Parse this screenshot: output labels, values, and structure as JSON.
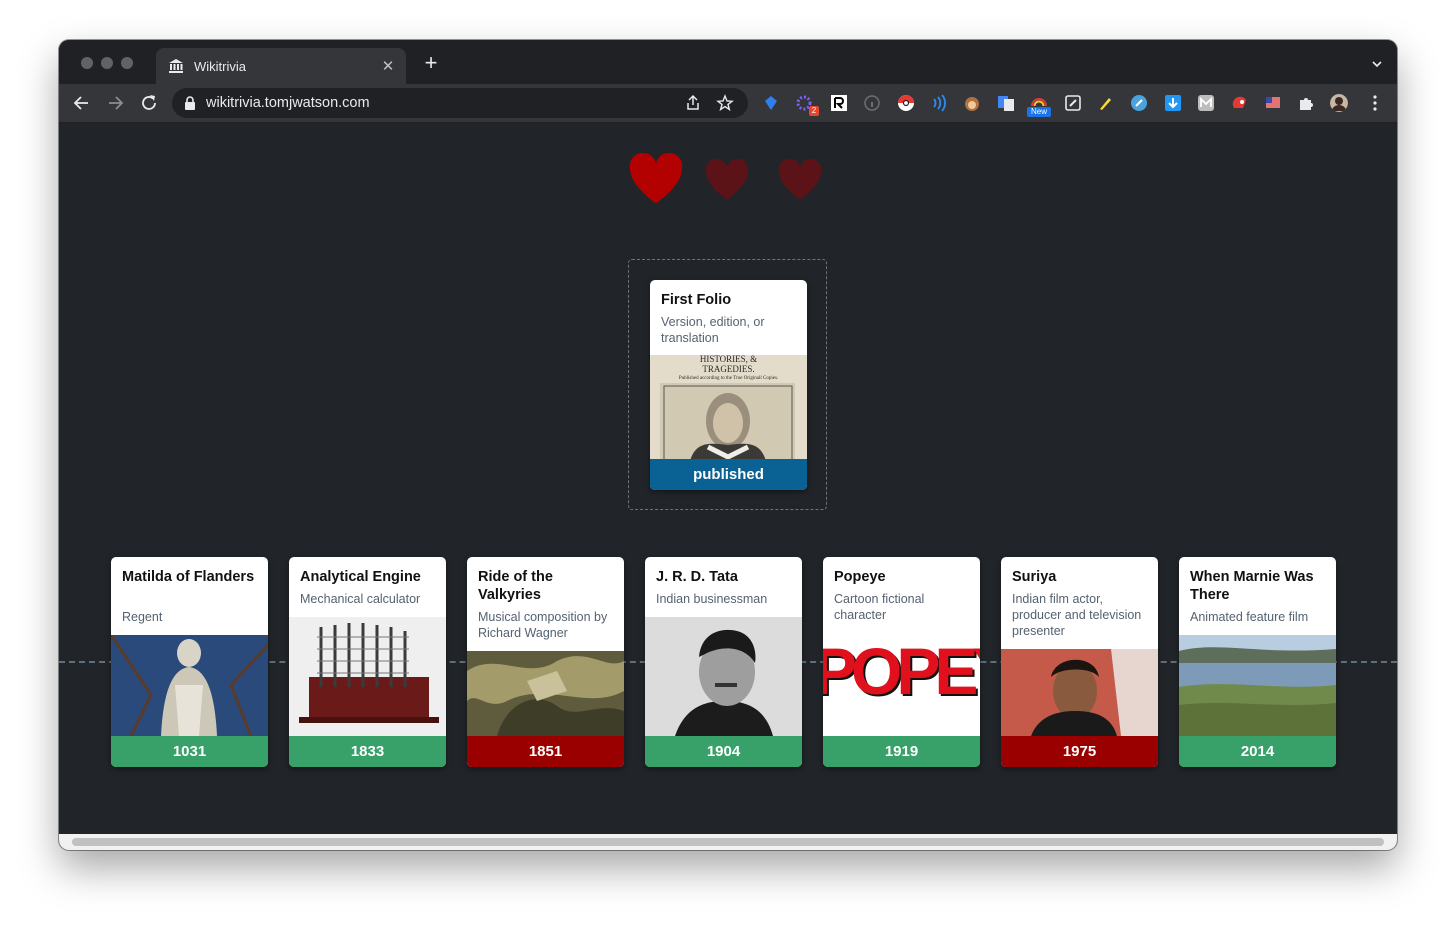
{
  "browser": {
    "tab_title": "Wikitrivia",
    "url": "wikitrivia.tomjwatson.com",
    "extension_badge_count": "2",
    "extension_new_label": "New"
  },
  "game": {
    "lives_total": 3,
    "lives_remaining": 1,
    "colors": {
      "heart_full": "#c80000",
      "heart_lost": "#5c1317",
      "correct": "#38a169",
      "wrong": "#9b0000",
      "pending": "#0a6193",
      "background": "#212529"
    },
    "current_card": {
      "title": "First Folio",
      "subtitle": "Version, edition, or translation",
      "image_text_line1": "HISTORIES, &",
      "image_text_line2": "TRAGEDIES.",
      "image_text_line3": "Published according to the True Originall Copies.",
      "label": "published"
    },
    "timeline": [
      {
        "title": "Matilda of Flanders",
        "subtitle": "Regent",
        "year": "1031",
        "status": "correct"
      },
      {
        "title": "Analytical Engine",
        "subtitle": "Mechanical calculator",
        "year": "1833",
        "status": "correct"
      },
      {
        "title": "Ride of the Valkyries",
        "subtitle": "Musical composition by Richard Wagner",
        "year": "1851",
        "status": "wrong"
      },
      {
        "title": "J. R. D. Tata",
        "subtitle": "Indian businessman",
        "year": "1904",
        "status": "correct"
      },
      {
        "title": "Popeye",
        "subtitle": "Cartoon fictional character",
        "year": "1919",
        "status": "correct",
        "image_text": "POPEYE"
      },
      {
        "title": "Suriya",
        "subtitle": "Indian film actor, producer and television presenter",
        "year": "1975",
        "status": "wrong"
      },
      {
        "title": "When Marnie Was There",
        "subtitle": "Animated feature film",
        "year": "2014",
        "status": "correct"
      }
    ]
  }
}
